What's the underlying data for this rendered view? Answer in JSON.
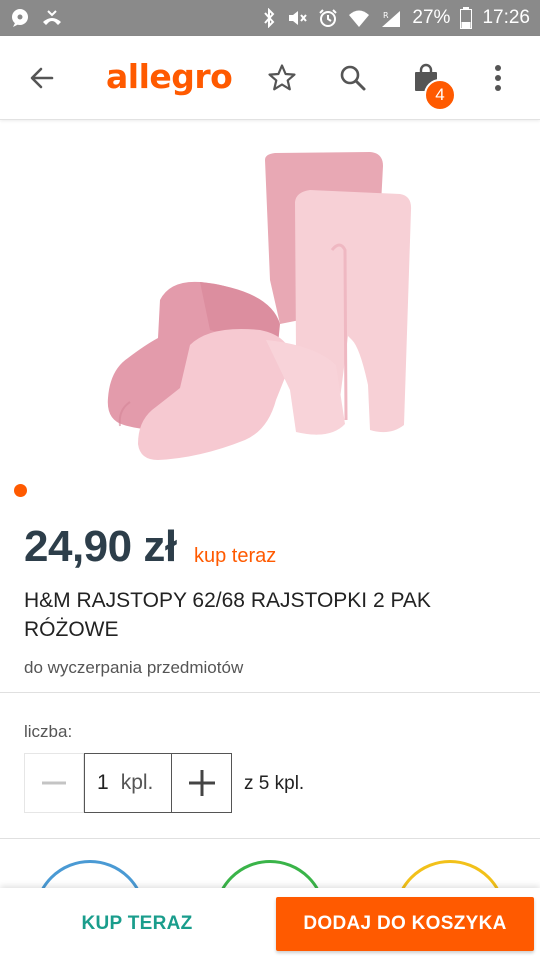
{
  "status_bar": {
    "battery": "27%",
    "time": "17:26",
    "signal_label": "R"
  },
  "app_bar": {
    "logo": "allegro",
    "cart_count": "4"
  },
  "product": {
    "price": "24,90 zł",
    "buy_now_tag": "kup teraz",
    "title": "H&M RAJSTOPY 62/68 RAJSTOPKI 2 PAK RÓŻOWE",
    "availability": "do wyczerpania przedmiotów"
  },
  "quantity": {
    "label": "liczba:",
    "value": "1",
    "unit": "kpl.",
    "max": "z 5 kpl."
  },
  "actions": {
    "buy_now": "KUP TERAZ",
    "add_to_cart": "DODAJ DO KOSZYKA"
  },
  "colors": {
    "brand": "#ff5a00",
    "teal": "#1a9d8c",
    "price": "#2d3e4a"
  }
}
